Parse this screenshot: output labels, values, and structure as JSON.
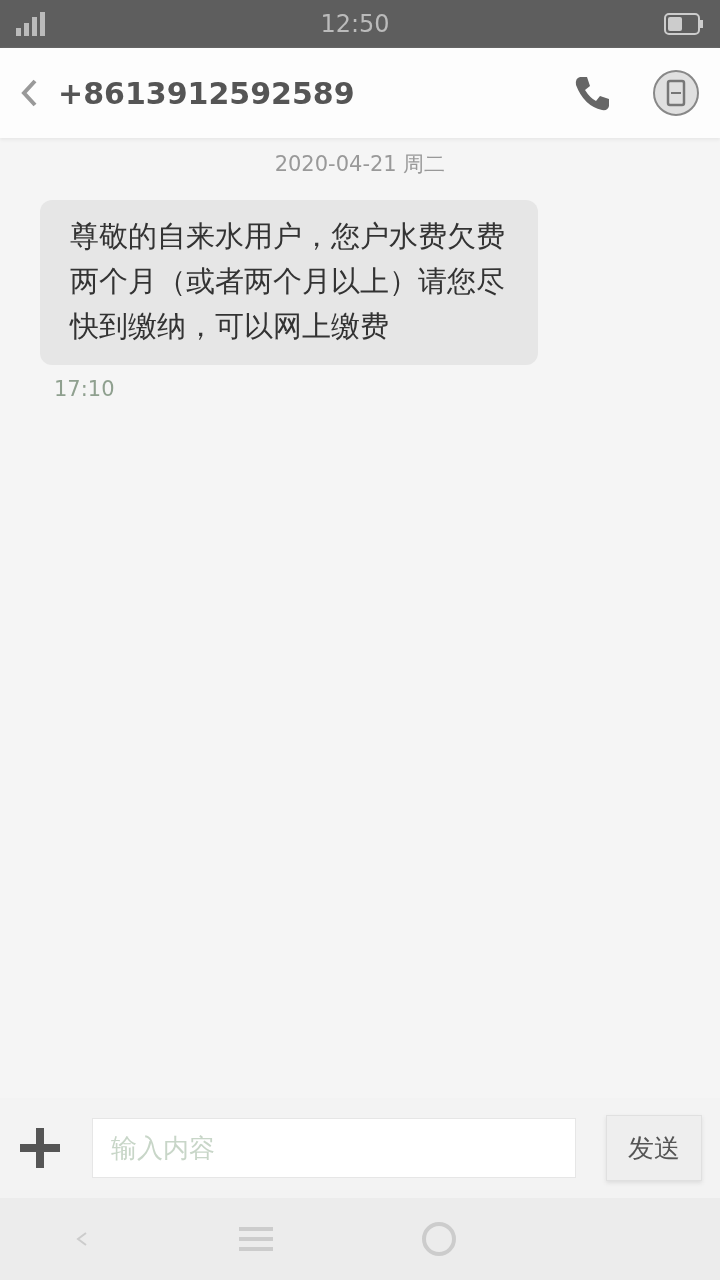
{
  "status_bar": {
    "time": "12:50"
  },
  "header": {
    "contact": "+8613912592589"
  },
  "messages": [
    {
      "date": "2020-04-21 周二",
      "text": "尊敬的自来水用户，您户水费欠费两个月（或者两个月以上）请您尽快到缴纳，可以网上缴费",
      "time": "17:10"
    }
  ],
  "composer": {
    "placeholder": "输入内容",
    "send": "发送"
  }
}
